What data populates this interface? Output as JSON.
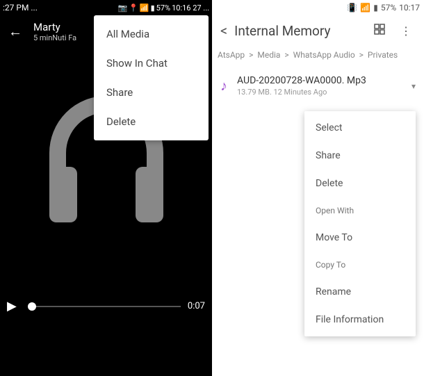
{
  "left": {
    "status": {
      "time_fragment": ":27 PM ...",
      "battery": "57%",
      "clock": "10:16 27 ..."
    },
    "header": {
      "name": "Marty",
      "subtitle": "5 minNuti Fa"
    },
    "menu": [
      "All Media",
      "Show In Chat",
      "Share",
      "Delete"
    ],
    "player": {
      "time": "0:07"
    }
  },
  "right": {
    "status": {
      "battery": "57%",
      "clock": "10:17"
    },
    "header": {
      "title": "Internal Memory"
    },
    "breadcrumb": [
      "AtsApp",
      "Media",
      "WhatsApp Audio",
      "Privates"
    ],
    "file": {
      "name": "AUD-20200728-WA0000. Mp3",
      "meta": "13.79 MB. 12 Minutes Ago"
    },
    "menu": [
      {
        "label": "Select",
        "small": false
      },
      {
        "label": "Share",
        "small": false
      },
      {
        "label": "Delete",
        "small": false
      },
      {
        "label": "Open With",
        "small": true
      },
      {
        "label": "Move To",
        "small": false
      },
      {
        "label": "Copy To",
        "small": true
      },
      {
        "label": "Rename",
        "small": false
      },
      {
        "label": "File Information",
        "small": false
      }
    ]
  }
}
